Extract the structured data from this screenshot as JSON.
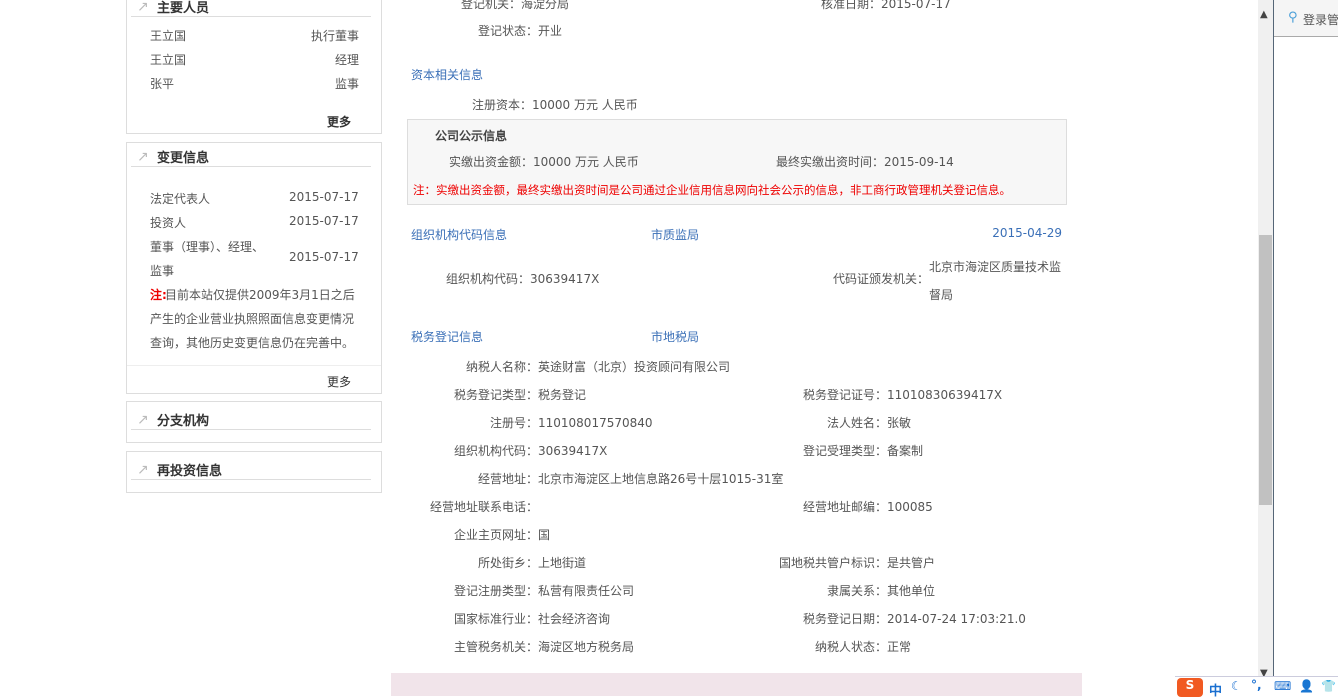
{
  "sidebar": {
    "people": {
      "title": "主要人员",
      "rows": [
        {
          "name": "王立国",
          "role": "执行董事"
        },
        {
          "name": "王立国",
          "role": "经理"
        },
        {
          "name": "张平",
          "role": "监事"
        }
      ],
      "more": "更多"
    },
    "changes": {
      "title": "变更信息",
      "rows": [
        {
          "item": "法定代表人",
          "date": "2015-07-17"
        },
        {
          "item": "投资人",
          "date": "2015-07-17"
        },
        {
          "item": "董事（理事）、经理、",
          "item2": "监事",
          "date": "2015-07-17"
        }
      ],
      "note_prefix": "注:",
      "note_lines": [
        "目前本站仅提供2009年3月1日之后",
        "产生的企业营业执照照面信息变更情况",
        "查询，其他历史变更信息仍在完善中。"
      ],
      "more": "更多"
    },
    "branches": {
      "title": "分支机构"
    },
    "reinvest": {
      "title": "再投资信息"
    }
  },
  "main": {
    "reg": {
      "authority_label": "登记机关：",
      "authority": "海淀分局",
      "approve_label": "核准日期：",
      "approve": "2015-07-17",
      "status_label": "登记状态：",
      "status": "开业"
    },
    "capital": {
      "title": "资本相关信息",
      "reg_label": "注册资本：",
      "reg_value": "10000 万元 人民币"
    },
    "public": {
      "title": "公司公示信息",
      "paid_label": "实缴出资金额：",
      "paid": "10000 万元 人民币",
      "time_label": "最终实缴出资时间：",
      "time": "2015-09-14",
      "note": "注：实缴出资金额，最终实缴出资时间是公司通过企业信用信息网向社会公示的信息，非工商行政管理机关登记信息。"
    },
    "org": {
      "title": "组织机构代码信息",
      "source": "市质监局",
      "date": "2015-04-29",
      "code_label": "组织机构代码：",
      "code": "30639417X",
      "issuer_label": "代码证颁发机关：",
      "issuer1": "北京市海淀区质量技术监",
      "issuer2": "督局"
    },
    "tax": {
      "title": "税务登记信息",
      "source": "市地税局",
      "left": [
        [
          "纳税人名称：",
          "英途财富（北京）投资顾问有限公司"
        ],
        [
          "税务登记类型：",
          "税务登记"
        ],
        [
          "注册号：",
          "110108017570840"
        ],
        [
          "组织机构代码：",
          "30639417X"
        ],
        [
          "经营地址：",
          "北京市海淀区上地信息路26号十层1015-31室"
        ],
        [
          "经营地址联系电话：",
          ""
        ],
        [
          "企业主页网址：",
          "国"
        ],
        [
          "所处街乡：",
          "上地街道"
        ],
        [
          "登记注册类型：",
          "私营有限责任公司"
        ],
        [
          "国家标准行业：",
          "社会经济咨询"
        ],
        [
          "主管税务机关：",
          "海淀区地方税务局"
        ]
      ],
      "right": [
        null,
        [
          "税务登记证号：",
          "11010830639417X"
        ],
        [
          "法人姓名：",
          "张敏"
        ],
        [
          "登记受理类型：",
          "备案制"
        ],
        null,
        [
          "经营地址邮编：",
          "100085"
        ],
        null,
        [
          "国地税共管户标识：",
          "是共管户"
        ],
        [
          "隶属关系：",
          "其他单位"
        ],
        [
          "税务登记日期：",
          "2014-07-24 17:03:21.0"
        ],
        [
          "纳税人状态：",
          "正常"
        ]
      ]
    }
  },
  "side_panel": {
    "login": "登录管"
  },
  "ime": {
    "lang": "中"
  }
}
